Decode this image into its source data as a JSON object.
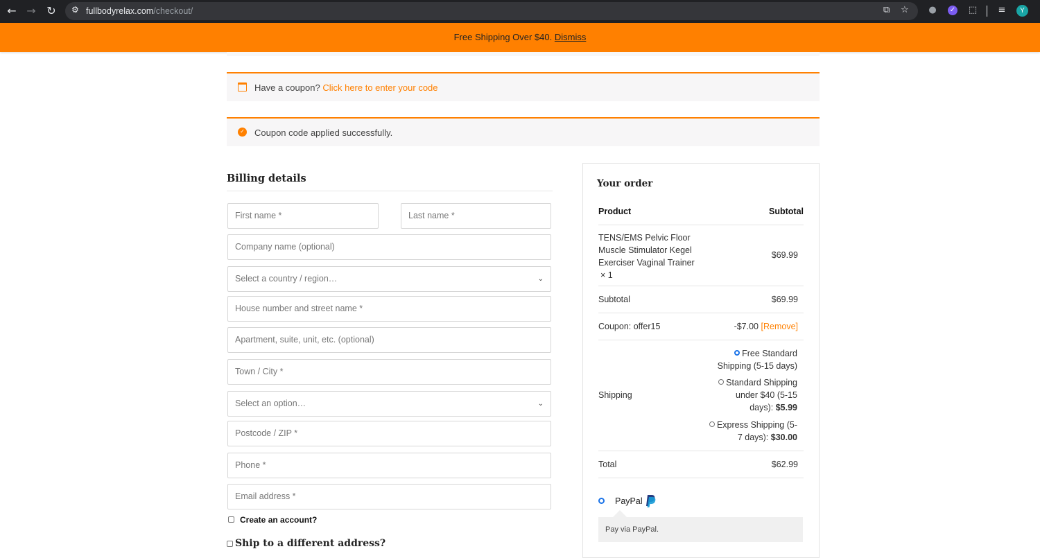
{
  "browser": {
    "url_host": "fullbodyrelax.com",
    "url_path": "/checkout/",
    "avatar_letter": "Y"
  },
  "notice": {
    "text": "Free Shipping Over $40.",
    "dismiss": "Dismiss"
  },
  "coupon_prompt": {
    "text": "Have a coupon?",
    "link": "Click here to enter your code"
  },
  "coupon_applied": {
    "text": "Coupon code applied successfully."
  },
  "billing": {
    "title": "Billing details",
    "first_name": "First name *",
    "last_name": "Last name *",
    "company": "Company name (optional)",
    "country": "Select a country / region…",
    "street": "House number and street name *",
    "apartment": "Apartment, suite, unit, etc. (optional)",
    "city": "Town / City *",
    "state": "Select an option…",
    "postcode": "Postcode / ZIP *",
    "phone": "Phone *",
    "email": "Email address *",
    "create_account": "Create an account?",
    "ship_different": "Ship to a different address?"
  },
  "order": {
    "title": "Your order",
    "col_product": "Product",
    "col_subtotal": "Subtotal",
    "item_name_1": "TENS/EMS Pelvic Floor",
    "item_name_2": "Muscle Stimulator Kegel",
    "item_name_3": "Exerciser Vaginal Trainer",
    "item_qty": "× 1",
    "item_price": "$69.99",
    "subtotal_label": "Subtotal",
    "subtotal_value": "$69.99",
    "coupon_label": "Coupon: offer15",
    "coupon_value": "-$7.00",
    "coupon_remove": "[Remove]",
    "shipping_label": "Shipping",
    "ship_opt1_a": "Free Standard",
    "ship_opt1_b": "Shipping (5-15 days)",
    "ship_opt2_a": "Standard Shipping",
    "ship_opt2_b": "under $40 (5-15",
    "ship_opt2_c": "days):",
    "ship_opt2_price": "$5.99",
    "ship_opt3_a": "Express Shipping (5-",
    "ship_opt3_b": "7 days):",
    "ship_opt3_price": "$30.00",
    "total_label": "Total",
    "total_value": "$62.99",
    "payment_label": "PayPal",
    "payment_desc": "Pay via PayPal."
  },
  "colors": {
    "accent": "#ff8000",
    "selected_radio": "#1a73e8"
  }
}
